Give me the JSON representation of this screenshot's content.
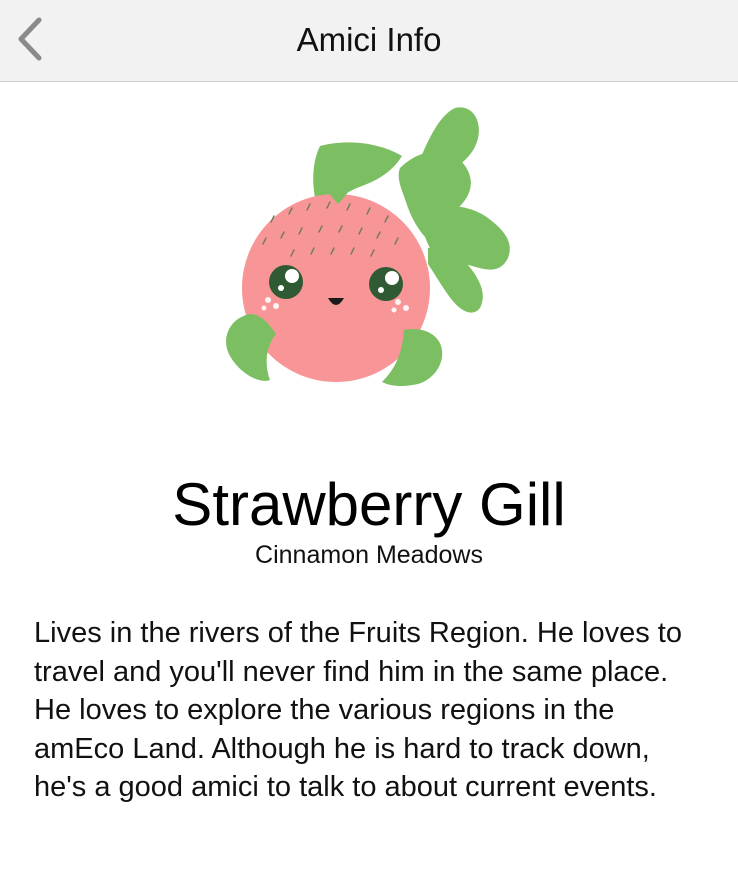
{
  "navbar": {
    "title": "Amici Info",
    "back_icon": "chevron-left-icon"
  },
  "amici": {
    "name": "Strawberry Gill",
    "location": "Cinnamon Meadows",
    "description": "Lives in the rivers of the Fruits Region. He loves to travel and you'll never find him in the same place. He loves to explore the various regions in the amEco Land. Although he is hard to track down, he's a good amici to talk to about current events.",
    "colors": {
      "body": "#f79597",
      "leaf": "#7cbf62",
      "eye": "#2f5a34"
    }
  }
}
